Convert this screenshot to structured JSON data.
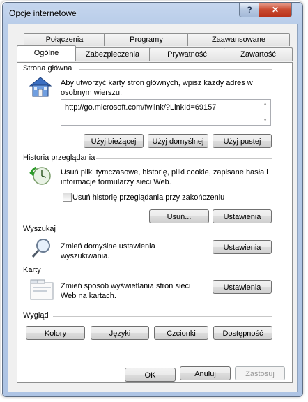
{
  "window": {
    "title": "Opcje internetowe",
    "help_glyph": "?",
    "close_glyph": "✕"
  },
  "tabs_row1": [
    "Połączenia",
    "Programy",
    "Zaawansowane"
  ],
  "tabs_row2": [
    "Ogólne",
    "Zabezpieczenia",
    "Prywatność",
    "Zawartość"
  ],
  "home": {
    "title": "Strona główna",
    "description": "Aby utworzyć karty stron głównych, wpisz każdy adres w osobnym wierszu.",
    "url": "http://go.microsoft.com/fwlink/?LinkId=69157",
    "btn_current": "Użyj bieżącej",
    "btn_default": "Użyj domyślnej",
    "btn_blank": "Użyj pustej",
    "icon": "house-icon"
  },
  "history": {
    "title": "Historia przeglądania",
    "description": "Usuń pliki tymczasowe, historię, pliki cookie, zapisane hasła i informacje formularzy sieci Web.",
    "checkbox_label": "Usuń historię przeglądania przy zakończeniu",
    "checkbox_checked": false,
    "btn_delete": "Usuń...",
    "btn_settings": "Ustawienia",
    "icon": "history-clock-icon"
  },
  "search": {
    "title": "Wyszukaj",
    "description": "Zmień domyślne ustawienia wyszukiwania.",
    "btn_settings": "Ustawienia",
    "icon": "magnifier-icon"
  },
  "tabs_section": {
    "title": "Karty",
    "description": "Zmień sposób wyświetlania stron sieci Web na kartach.",
    "btn_settings": "Ustawienia",
    "icon": "tabs-window-icon"
  },
  "appearance": {
    "title": "Wygląd",
    "btn_colors": "Kolory",
    "btn_languages": "Języki",
    "btn_fonts": "Czcionki",
    "btn_accessibility": "Dostępność"
  },
  "footer": {
    "ok": "OK",
    "cancel": "Anuluj",
    "apply": "Zastosuj"
  }
}
